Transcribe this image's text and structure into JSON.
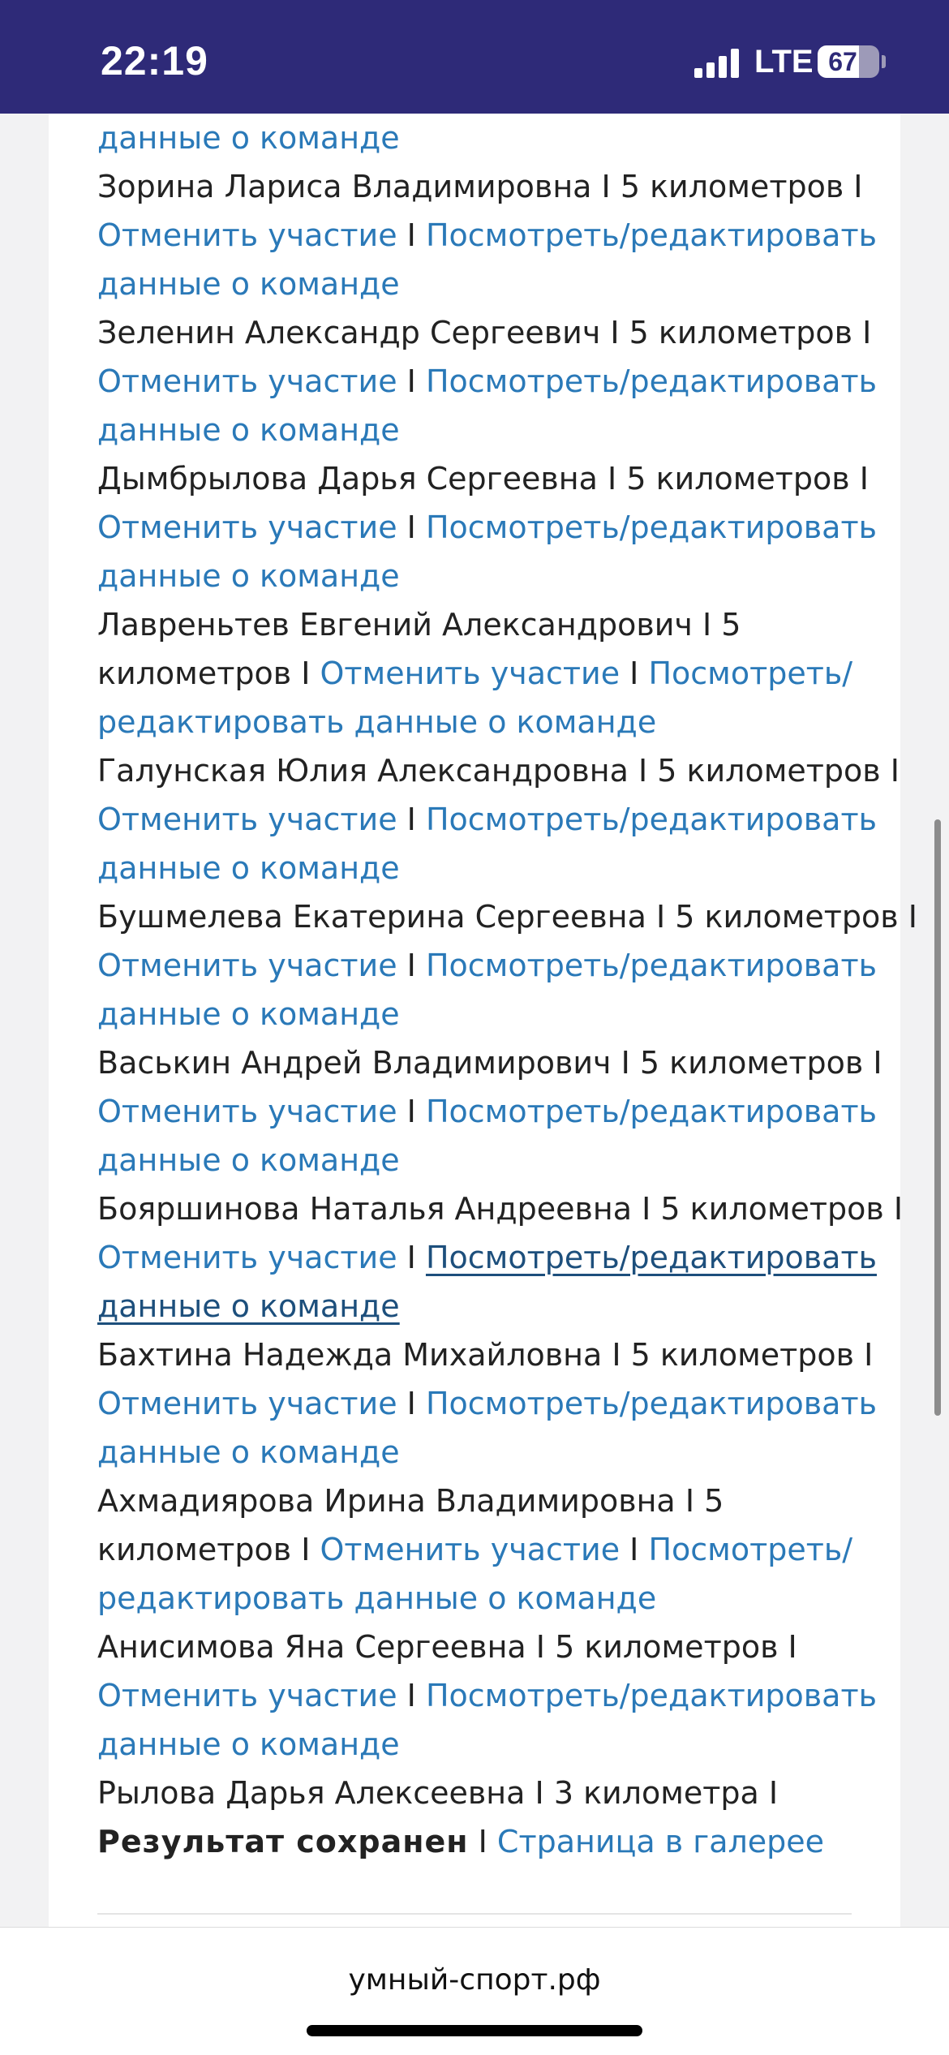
{
  "status_bar": {
    "time": "22:19",
    "network": "LTE",
    "battery_percent": "67",
    "battery_level": 0.67
  },
  "browser": {
    "url": "умный-спорт.рф"
  },
  "colors": {
    "status_bar_bg": "#2e2a78",
    "link": "#2a79b8",
    "link_hover": "#1d4f7c"
  },
  "participants": {
    "top_fragment": "данные о команде",
    "items": [
      {
        "name": "Зорина Лариса Владимировна",
        "distance": "5 километров",
        "cancel": "Отменить участие",
        "edit": "Посмотреть/редактировать данные о команде"
      },
      {
        "name": "Зеленин Александр Сергеевич",
        "distance": "5 километров",
        "cancel": "Отменить участие",
        "edit": "Посмотреть/редактировать данные о команде"
      },
      {
        "name": "Дымбрылова Дарья Сергеевна",
        "distance": "5 километров",
        "cancel": "Отменить участие",
        "edit": "Посмотреть/редактировать данные о команде"
      },
      {
        "name": "Лавреньтев Евгений Александрович",
        "distance": "5 километров",
        "cancel": "Отменить участие",
        "edit": "Посмотреть/редактировать данные о команде"
      },
      {
        "name": "Галунская Юлия Александровна",
        "distance": "5 километров",
        "cancel": "Отменить участие",
        "edit": "Посмотреть/редактировать данные о команде"
      },
      {
        "name": "Бушмелева Екатерина Сергеевна",
        "distance": "5 километров",
        "cancel": "Отменить участие",
        "edit": "Посмотреть/редактировать данные о команде"
      },
      {
        "name": "Васькин Андрей Владимирович",
        "distance": "5 километров",
        "cancel": "Отменить участие",
        "edit": "Посмотреть/редактировать данные о команде"
      },
      {
        "name": "Бояршинова Наталья Андреевна",
        "distance": "5 километров",
        "cancel": "Отменить участие",
        "edit": "Посмотреть/редактировать данные о команде"
      },
      {
        "name": "Бахтина Надежда Михайловна",
        "distance": "5 километров",
        "cancel": "Отменить участие",
        "edit": "Посмотреть/редактировать данные о команде"
      },
      {
        "name": "Ахмадиярова Ирина Владимировна",
        "distance": "5 километров",
        "cancel": "Отменить участие",
        "edit": "Посмотреть/редактировать данные о команде"
      },
      {
        "name": "Анисимова Яна Сергеевна",
        "distance": "5 километров",
        "cancel": "Отменить участие",
        "edit": "Посмотреть/редактировать данные о команде"
      }
    ],
    "last": {
      "name": "Рылова Дарья Алексеевна",
      "distance": "3 километра",
      "result": "Результат сохранен",
      "gallery": "Страница в галерее"
    }
  }
}
